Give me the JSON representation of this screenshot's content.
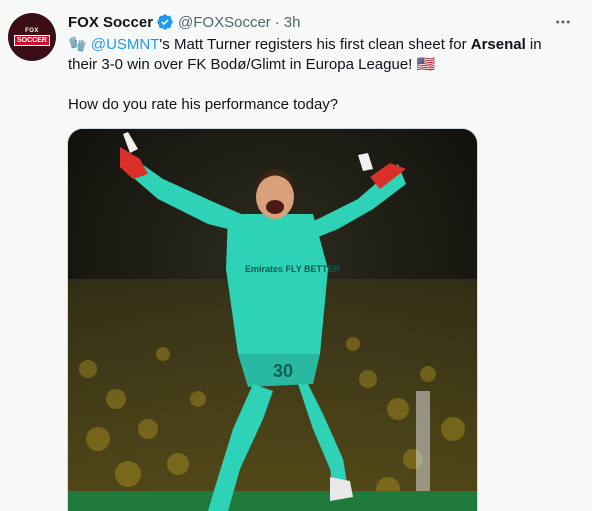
{
  "tweet": {
    "author_name": "FOX Soccer",
    "handle": "@FOXSoccer",
    "separator": "·",
    "time": "3h",
    "avatar_text_top": "FOX",
    "avatar_text_bottom": "SOCCER",
    "text_line1_emoji": "🧤",
    "mention": "@USMNT",
    "text_line1_mid": "'s Matt Turner registers his first clean sheet for ",
    "text_bold": "Arsenal",
    "text_line1_end": " in their 3-0 win over FK Bodø/Glimt in Europa League! 🇺🇸",
    "question": "How do you rate his performance today?",
    "jersey_sponsor": "Emirates FLY BETTER",
    "jersey_number": "30"
  },
  "colors": {
    "link": "#1d9bf0",
    "verified": "#1d9bf0",
    "muted": "#536471",
    "kit": "#2ed3b7"
  },
  "icons": {
    "verified": "verified-badge-icon",
    "more": "more-options-icon"
  }
}
